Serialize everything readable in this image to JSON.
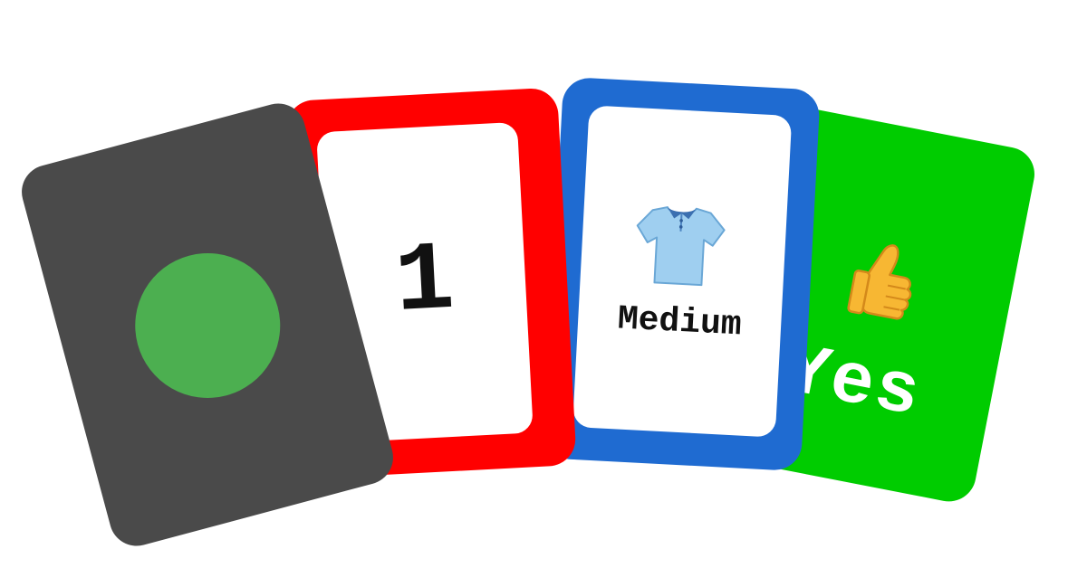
{
  "cards": {
    "dot": {
      "card_color": "#4a4a4a",
      "dot_color": "#4caf50",
      "icon": "green-circle"
    },
    "one": {
      "border_color": "#ff0000",
      "text": "1"
    },
    "medium": {
      "border_color": "#1f6bd1",
      "icon": "shirt",
      "text": "Medium"
    },
    "yes": {
      "card_color": "#00cc00",
      "icon": "thumbs-up",
      "text": "Yes"
    }
  }
}
